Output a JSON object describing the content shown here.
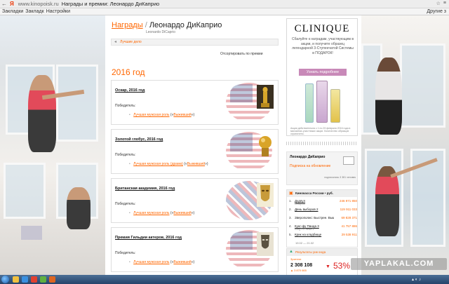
{
  "browser": {
    "logo": "Я",
    "url": "www.kinopoisk.ru",
    "tab_title": "Награды и премии: Леонардо ДиКаприо",
    "right_label": "Другие з",
    "bookmarks": [
      "Закладки",
      "Закладк",
      "Настройки"
    ]
  },
  "page": {
    "breadcrumb_root": "Награды",
    "breadcrumb_separator": "/",
    "breadcrumb_current": "Леонардо ДиКаприо",
    "original_name": "Leonardo DiCaprio",
    "back_link": "Лучшие дело",
    "sort_link": "Отсортировать по премии",
    "year": "2016 год",
    "awards": [
      {
        "title": "Оскар, 2016 год",
        "winner_label": "Победитель:",
        "category": "Лучшая мужская роль",
        "movie": "Выживший"
      },
      {
        "title": "Золотой глобус, 2016 год",
        "winner_label": "Победитель:",
        "category": "Лучшая мужская роль (драма)",
        "movie": "Выживший"
      },
      {
        "title": "Британская академия, 2016 год",
        "winner_label": "Победитель:",
        "category": "Лучшая мужская роль",
        "movie": "Выживший"
      },
      {
        "title": "Премия Гильдии актеров, 2016 год",
        "winner_label": "Победитель:",
        "category": "Лучшая мужская роль",
        "movie": "Выживший"
      }
    ]
  },
  "ad": {
    "brand": "CLINIQUE",
    "text": "Сбалуйте к наградам, участвующим в акции, и получите образец легендарной 3-Ступенчатой Системы в ПОДАРОК!",
    "button": "Узнать подробнее",
    "fine_print": "Акция действительна с 1 по 29 февраля 2016 года в магазинах-участниках акции. Количество образцов ограничено."
  },
  "subscribe": {
    "name": "Леонардо ДиКаприо",
    "link": "Подписка на обновление",
    "count": "подписались 3 381 человек"
  },
  "box_office": {
    "title": "Кинокасса России • руб.",
    "rows": [
      {
        "rank": "1.",
        "title": "Дэдпул",
        "sub": "Deadpool",
        "amount": "246 971 850"
      },
      {
        "rank": "2.",
        "title": "День выборов 2",
        "sub": "",
        "amount": "119 911 033"
      },
      {
        "rank": "3.",
        "title": "Зверополис: Быстрее. Выше. Сильнее",
        "sub": "",
        "amount": "69 828 371"
      },
      {
        "rank": "4.",
        "title": "Кунг-фу Панда 3",
        "sub": "Kung Fu Panda 3",
        "amount": "41 757 886"
      },
      {
        "rank": "5.",
        "title": "Крик на кладбище",
        "sub": "",
        "amount": "29 538 911"
      }
    ],
    "footer": "19.02 — 21.02"
  },
  "results": {
    "title": "Результаты уик-энда",
    "label": "Зрители",
    "value": "2 308 108",
    "prev": "▲ 3 870 665",
    "percent": "53%"
  },
  "watermark": "YAPLAKAL.COM",
  "colors": {
    "accent": "#ff6600",
    "ad_button": "#c889b8",
    "taskbar": "#26436a"
  }
}
